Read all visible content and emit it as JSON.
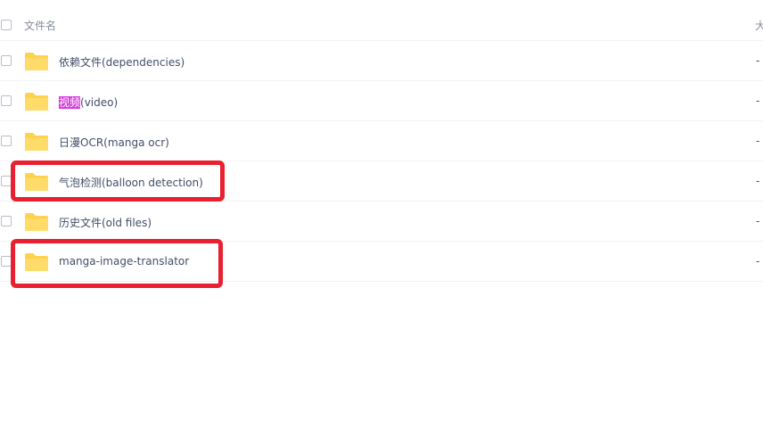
{
  "header": {
    "name_label": "文件名",
    "size_label": "大小"
  },
  "rows": [
    {
      "name": "依赖文件(dependencies)",
      "size": "-"
    },
    {
      "name_highlight": "视频",
      "name_rest": "(video)",
      "size": "-"
    },
    {
      "name": "日漫OCR(manga ocr)",
      "size": "-"
    },
    {
      "name": "气泡检测(balloon detection)",
      "size": "-"
    },
    {
      "name": "历史文件(old files)",
      "size": "-"
    },
    {
      "name": "manga-image-translator",
      "size": "-"
    }
  ],
  "colors": {
    "folder": "#ffd24d",
    "highlight": "#d63adb",
    "annotation": "#e8202f"
  },
  "icons": {
    "folder": "folder-icon"
  }
}
